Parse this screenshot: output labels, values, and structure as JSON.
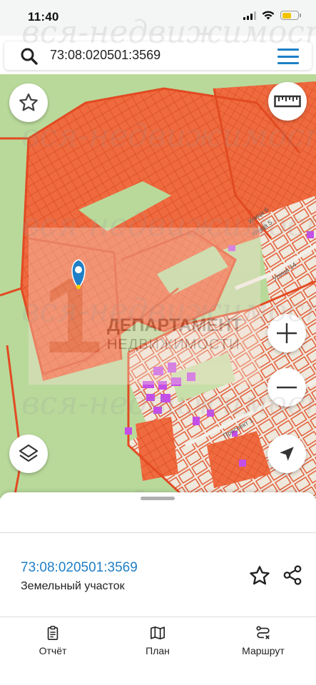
{
  "status_bar": {
    "time": "11:40"
  },
  "search": {
    "value": "73:08:020501:3569"
  },
  "map": {
    "logo_title": "ДЕПАРТАМЕНТ",
    "logo_subtitle": "НЕДВИЖИМОСТИ",
    "street_labels": [
      "Улица 5",
      "Улица 14",
      "Улица 6",
      "Проспект 1"
    ],
    "colors": {
      "base": "#b9d99b",
      "parcel": "#ef6a3f",
      "parcel_line": "#e24a22",
      "building": "#c44ee8",
      "marker": "#1e7fc6"
    }
  },
  "watermark": {
    "text": "вся-недвижимость.net"
  },
  "sheet": {
    "parcel_number": "73:08:020501:3569",
    "parcel_type": "Земельный участок"
  },
  "tabs": [
    {
      "label": "Отчёт",
      "icon": "clipboard-icon"
    },
    {
      "label": "План",
      "icon": "map-icon"
    },
    {
      "label": "Маршрут",
      "icon": "route-icon"
    }
  ]
}
